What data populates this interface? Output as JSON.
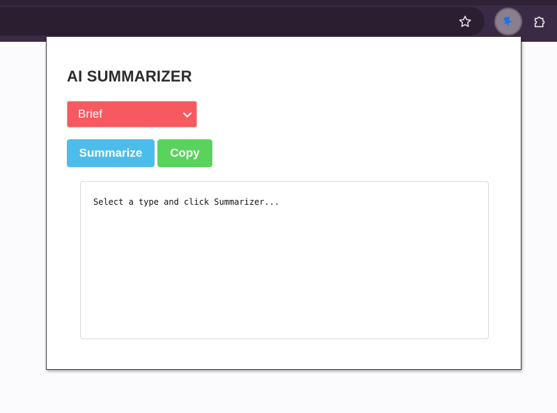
{
  "browser": {
    "toolbar_icons": [
      "star-icon",
      "extension-pin-icon",
      "extensions-puzzle-icon"
    ],
    "active_extension_color": "#1a73e8"
  },
  "popup": {
    "title": "AI SUMMARIZER",
    "summary_type": {
      "selected": "Brief"
    },
    "buttons": {
      "summarize_label": "Summarize",
      "copy_label": "Copy"
    },
    "result_text": "Select a type and click Summarizer...",
    "colors": {
      "select_bg": "#f6595f",
      "summarize_bg": "#4cbdeb",
      "copy_bg": "#5ad35c"
    }
  }
}
